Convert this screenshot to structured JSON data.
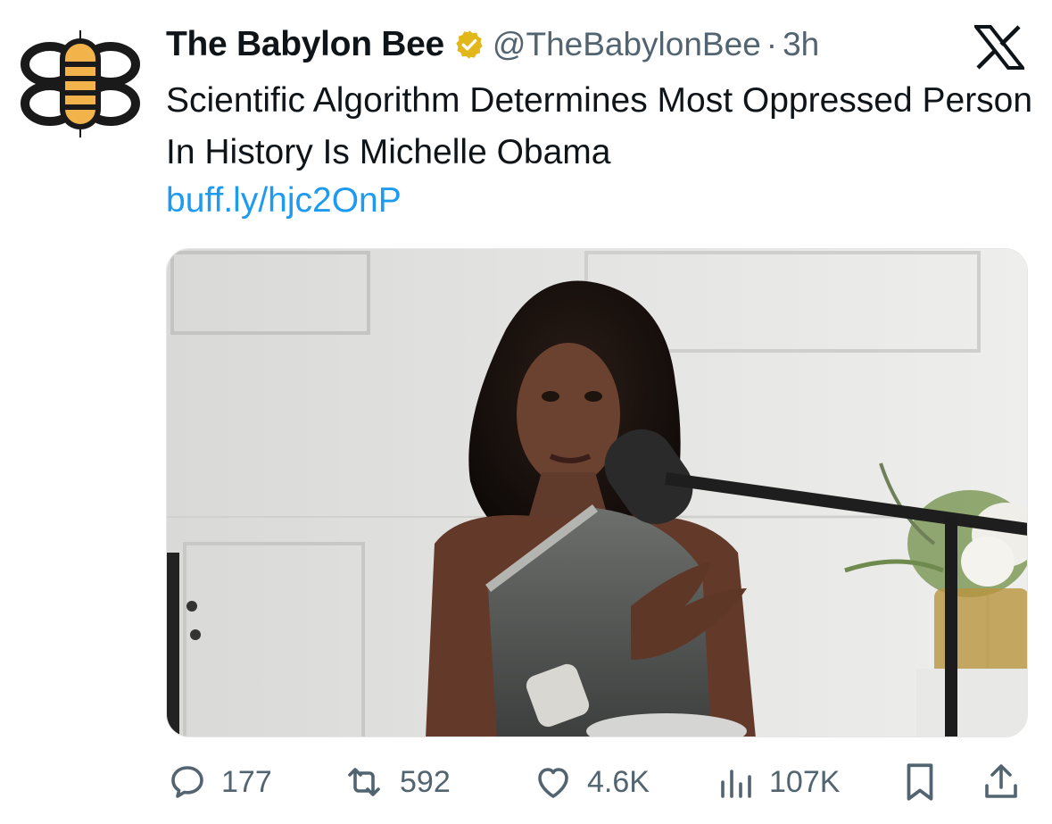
{
  "tweet": {
    "display_name": "The Babylon Bee",
    "handle": "@TheBabylonBee",
    "separator": "·",
    "time": "3h",
    "text": "Scientific Algorithm Determines Most Oppressed Person In History Is Michelle Obama",
    "link": "buff.ly/hjc2OnP",
    "platform_icon": "x-logo-icon",
    "verified_badge": "gold-verified-icon"
  },
  "actions": {
    "replies": "177",
    "reposts": "592",
    "likes": "4.6K",
    "views": "107K"
  },
  "colors": {
    "text": "#0f1419",
    "secondary": "#536471",
    "link": "#1d9bf0",
    "verified_gold": "#e2b719",
    "bee_yellow": "#f2b44a"
  }
}
